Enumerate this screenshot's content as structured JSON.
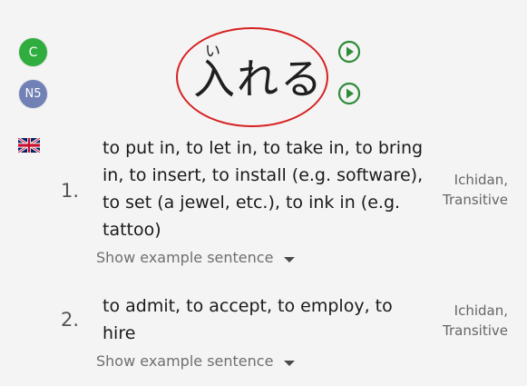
{
  "badges": {
    "common": "C",
    "jlpt": "N5"
  },
  "word": {
    "reading": "い",
    "text": "入れる"
  },
  "icons": {
    "language_flag": "uk-flag-icon",
    "audio": "play-circle-icon"
  },
  "senses": [
    {
      "number": "1.",
      "text": "to put in, to let in, to take in, to bring in, to insert, to install (e.g. software), to set (a jewel, etc.), to ink in (e.g. tattoo)",
      "meta_line1": "Ichidan,",
      "meta_line2": "Transitive",
      "example_label": "Show example sentence"
    },
    {
      "number": "2.",
      "text": "to admit, to accept, to employ, to hire",
      "meta_line1": "Ichidan,",
      "meta_line2": "Transitive",
      "example_label": "Show example sentence"
    }
  ],
  "colors": {
    "common_badge": "#2fae3f",
    "jlpt_badge": "#7181b5",
    "play_button": "#2e8b3a",
    "highlight_circle": "#d62020",
    "background": "#f4f4f4"
  }
}
